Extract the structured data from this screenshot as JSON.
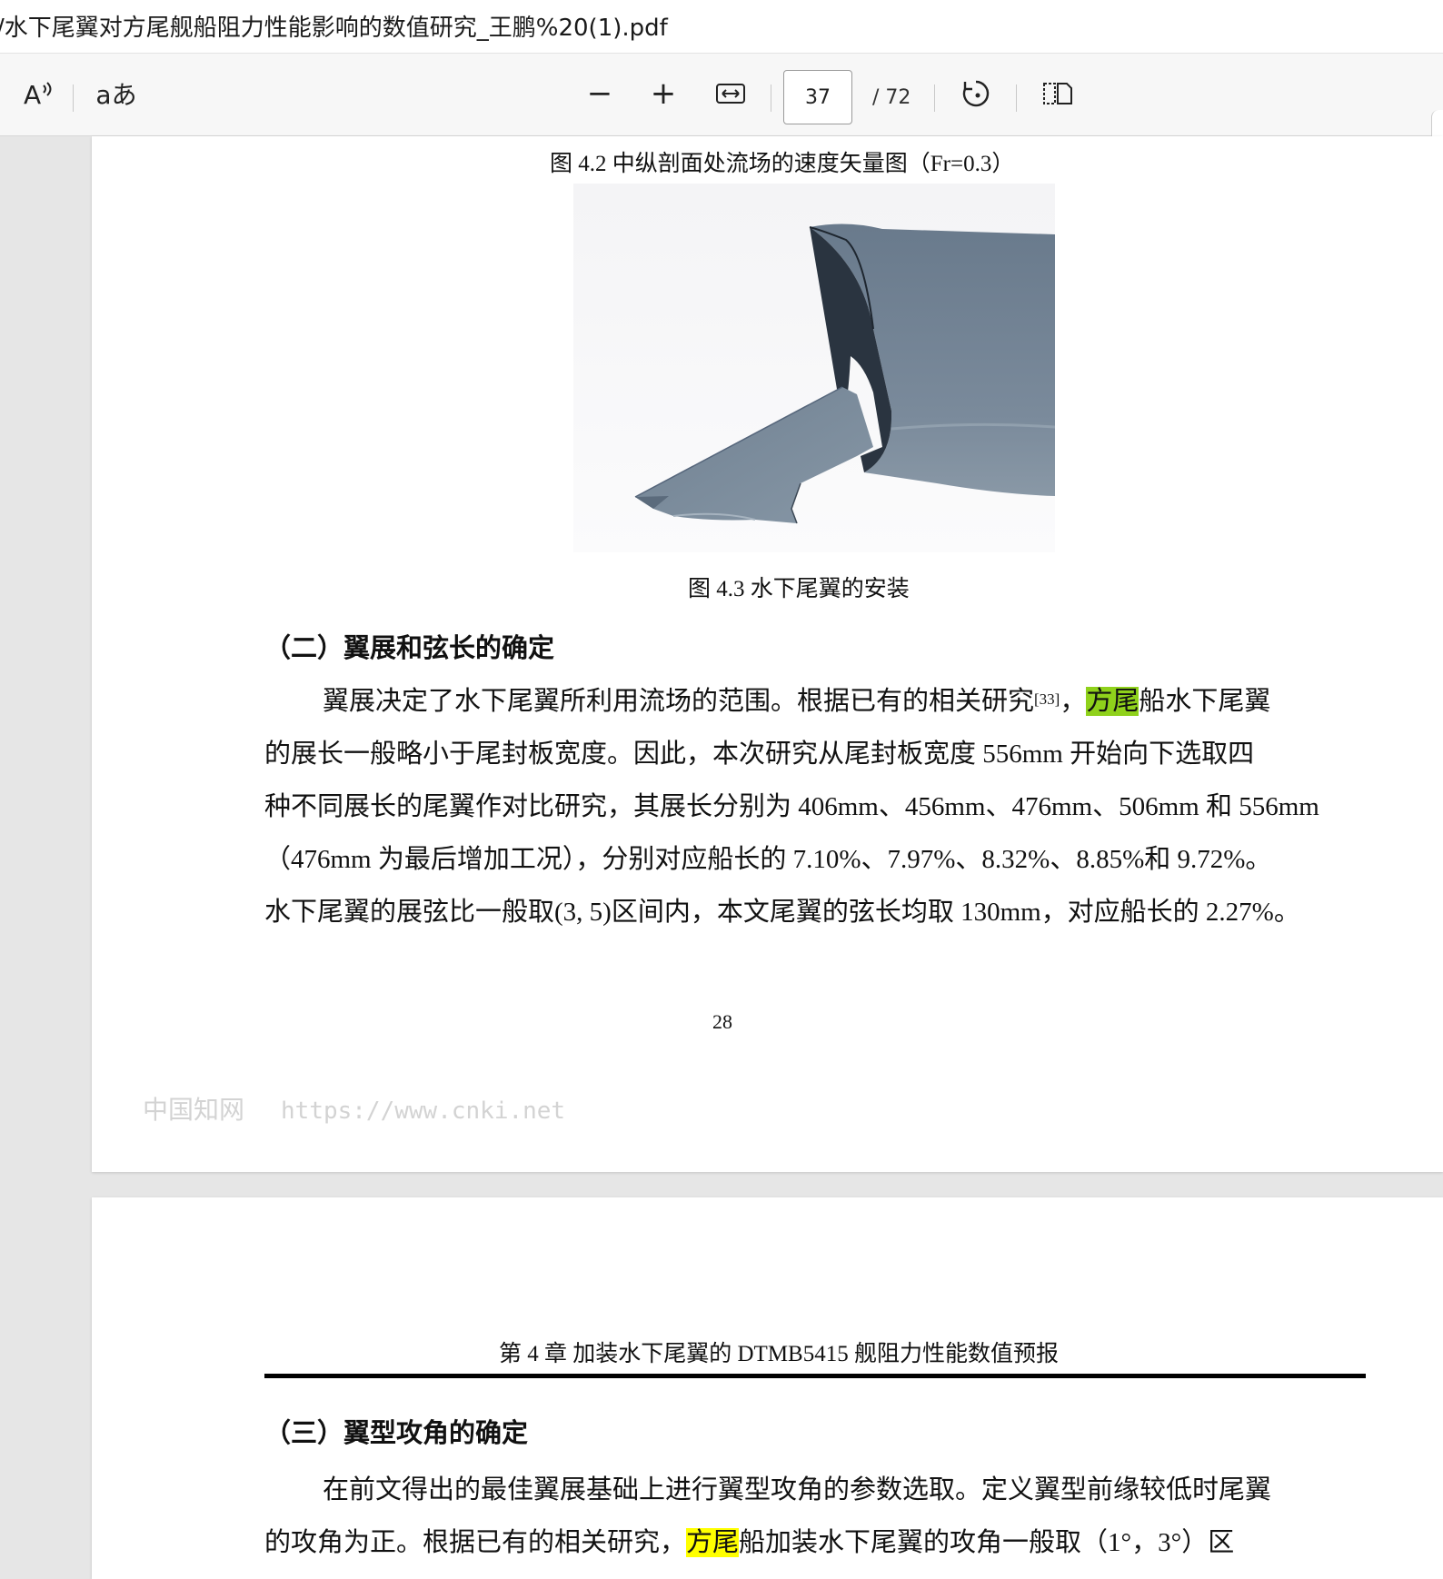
{
  "window": {
    "title": "/水下尾翼对方尾舰船阻力性能影响的数值研究_王鹏%20(1).pdf"
  },
  "toolbar": {
    "read_aloud_icon": "read-aloud-icon",
    "translate_label": "aあ",
    "zoom_out_label": "−",
    "zoom_in_label": "+",
    "current_page": "37",
    "total_pages": "/ 72"
  },
  "page1": {
    "figure_caption_top": "图 4.2  中纵剖面处流场的速度矢量图（Fr=0.3）",
    "figure_caption": "图 4.3  水下尾翼的安装",
    "section_heading": "（二）翼展和弦长的确定",
    "para_line1_a": "翼展决定了水下尾翼所利用流场的范围。根据已有的相关研究",
    "para_line1_ref": "[33]",
    "para_line1_b": "，",
    "para_line1_hl": "方尾",
    "para_line1_c": "船水下尾翼",
    "para_line2": "的展长一般略小于尾封板宽度。因此，本次研究从尾封板宽度 556mm 开始向下选取四",
    "para_line3": "种不同展长的尾翼作对比研究，其展长分别为 406mm、456mm、476mm、506mm 和 556mm",
    "para_line4": "（476mm 为最后增加工况），分别对应船长的 7.10%、7.97%、8.32%、8.85%和 9.72%。",
    "para_line5": "水下尾翼的展弦比一般取(3, 5)区间内，本文尾翼的弦长均取 130mm，对应船长的 2.27%。",
    "page_number": "28",
    "watermark_cn": "中国知网",
    "watermark_url": "https://www.cnki.net"
  },
  "page2": {
    "chapter_header": "第 4 章  加装水下尾翼的 DTMB5415 舰阻力性能数值预报",
    "section_heading": "（三）翼型攻角的确定",
    "para_line1": "在前文得出的最佳翼展基础上进行翼型攻角的参数选取。定义翼型前缘较低时尾翼",
    "para_line2_a": "的攻角为正。根据已有的相关研究，",
    "para_line2_hl": "方尾",
    "para_line2_b": "船加装水下尾翼的攻角一般取（1°，3°）区"
  },
  "colors": {
    "highlight_active": "#8fd11b",
    "highlight": "#ffff00"
  }
}
